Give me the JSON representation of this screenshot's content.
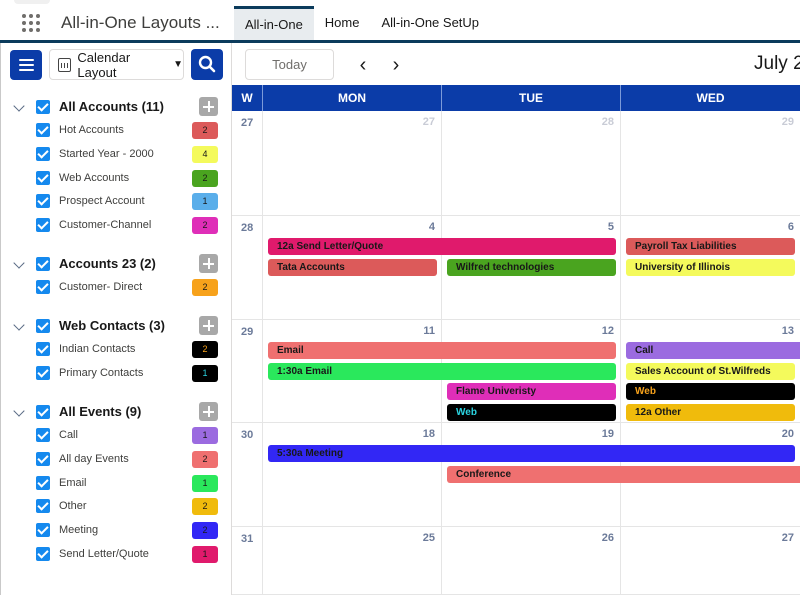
{
  "header": {
    "app_title": "All-in-One Layouts ...",
    "tabs": [
      {
        "label": "All-in-One",
        "active": true
      },
      {
        "label": "Home",
        "active": false
      },
      {
        "label": "All-in-One SetUp",
        "active": false
      }
    ]
  },
  "toolbar": {
    "layout_select": "Calendar Layout",
    "today_label": "Today",
    "prev_icon": "‹",
    "next_icon": "›",
    "month_title": "July 2"
  },
  "sidebar": {
    "groups": [
      {
        "title": "All Accounts (11)",
        "items": [
          {
            "label": "Hot Accounts",
            "count": "2",
            "color": "#dc5a5a",
            "text_color": "#181818"
          },
          {
            "label": "Started Year - 2000",
            "count": "4",
            "color": "#f4fa5c",
            "text_color": "#181818"
          },
          {
            "label": "Web Accounts",
            "count": "2",
            "color": "#4aa41f",
            "text_color": "#181818"
          },
          {
            "label": "Prospect Account",
            "count": "1",
            "color": "#5aaeea",
            "text_color": "#181818"
          },
          {
            "label": "Customer-Channel",
            "count": "2",
            "color": "#df2eb8",
            "text_color": "#181818"
          }
        ]
      },
      {
        "title": "Accounts 23 (2)",
        "items": [
          {
            "label": "Customer- Direct",
            "count": "2",
            "color": "#f7a21b",
            "text_color": "#181818"
          }
        ]
      },
      {
        "title": "Web Contacts (3)",
        "items": [
          {
            "label": "Indian Contacts",
            "count": "2",
            "color": "#000000",
            "text_color": "#f7a21b"
          },
          {
            "label": "Primary Contacts",
            "count": "1",
            "color": "#000000",
            "text_color": "#2ad3e0"
          }
        ]
      },
      {
        "title": "All Events (9)",
        "items": [
          {
            "label": "Call",
            "count": "1",
            "color": "#9b6be0",
            "text_color": "#181818"
          },
          {
            "label": "All day Events",
            "count": "2",
            "color": "#ef7070",
            "text_color": "#181818"
          },
          {
            "label": "Email",
            "count": "1",
            "color": "#2ae85c",
            "text_color": "#181818"
          },
          {
            "label": "Other",
            "count": "2",
            "color": "#f0bb0c",
            "text_color": "#181818"
          },
          {
            "label": "Meeting",
            "count": "2",
            "color": "#3227f5",
            "text_color": "#181818"
          },
          {
            "label": "Send Letter/Quote",
            "count": "1",
            "color": "#e01a6c",
            "text_color": "#181818"
          }
        ]
      }
    ]
  },
  "calendar": {
    "headers": [
      "W",
      "MON",
      "TUE",
      "WED"
    ],
    "weeks": [
      {
        "week": "27",
        "days": [
          {
            "n": "27",
            "muted": true
          },
          {
            "n": "28",
            "muted": true
          },
          {
            "n": "29",
            "muted": true
          }
        ],
        "events": []
      },
      {
        "week": "28",
        "days": [
          {
            "n": "4"
          },
          {
            "n": "5"
          },
          {
            "n": "6"
          }
        ],
        "events": [
          {
            "label": "12a Send Letter/Quote",
            "start": 0,
            "span": 2,
            "row": 0,
            "color": "#e01a6c",
            "text": "#181818"
          },
          {
            "label": "Tata Accounts",
            "start": 0,
            "span": 1,
            "row": 1,
            "color": "#dc5a5a",
            "text": "#181818"
          },
          {
            "label": "Wilfred technologies",
            "start": 1,
            "span": 1,
            "row": 1,
            "color": "#4aa41f",
            "text": "#181818"
          },
          {
            "label": "Payroll Tax Liabilities",
            "start": 2,
            "span": 1,
            "row": 0,
            "color": "#dc5a5a",
            "text": "#181818"
          },
          {
            "label": "University of Illinois",
            "start": 2,
            "span": 1,
            "row": 1,
            "color": "#f4fa5c",
            "text": "#181818"
          }
        ]
      },
      {
        "week": "29",
        "days": [
          {
            "n": "11"
          },
          {
            "n": "12"
          },
          {
            "n": "13"
          }
        ],
        "events": [
          {
            "label": "Email",
            "start": 0,
            "span": 2,
            "row": 0,
            "color": "#ef7070",
            "text": "#181818"
          },
          {
            "label": "1:30a Email",
            "start": 0,
            "span": 2,
            "row": 1,
            "color": "#2ae85c",
            "text": "#181818"
          },
          {
            "label": "Flame Univeristy",
            "start": 1,
            "span": 1,
            "row": 2,
            "color": "#df2eb8",
            "text": "#181818"
          },
          {
            "label": "Web",
            "start": 1,
            "span": 1,
            "row": 3,
            "color": "#000000",
            "text": "#2ad3e0"
          },
          {
            "label": "Call",
            "start": 2,
            "span": 1,
            "row": 0,
            "color": "#9b6be0",
            "text": "#181818",
            "open_right": true
          },
          {
            "label": "Sales Account of St.Wilfreds",
            "start": 2,
            "span": 1,
            "row": 1,
            "color": "#f4fa5c",
            "text": "#181818"
          },
          {
            "label": "Web",
            "start": 2,
            "span": 1,
            "row": 2,
            "color": "#000000",
            "text": "#f7a21b"
          },
          {
            "label": "12a Other",
            "start": 2,
            "span": 1,
            "row": 3,
            "color": "#f0bb0c",
            "text": "#181818"
          }
        ]
      },
      {
        "week": "30",
        "days": [
          {
            "n": "18"
          },
          {
            "n": "19"
          },
          {
            "n": "20"
          }
        ],
        "events": [
          {
            "label": "5:30a Meeting",
            "start": 0,
            "span": 3,
            "row": 0,
            "color": "#3227f5",
            "text": "#181818"
          },
          {
            "label": "Conference",
            "start": 1,
            "span": 2,
            "row": 1,
            "color": "#ef7070",
            "text": "#181818",
            "open_right": true
          }
        ]
      },
      {
        "week": "31",
        "days": [
          {
            "n": "25"
          },
          {
            "n": "26"
          },
          {
            "n": "27"
          }
        ],
        "events": []
      }
    ]
  }
}
